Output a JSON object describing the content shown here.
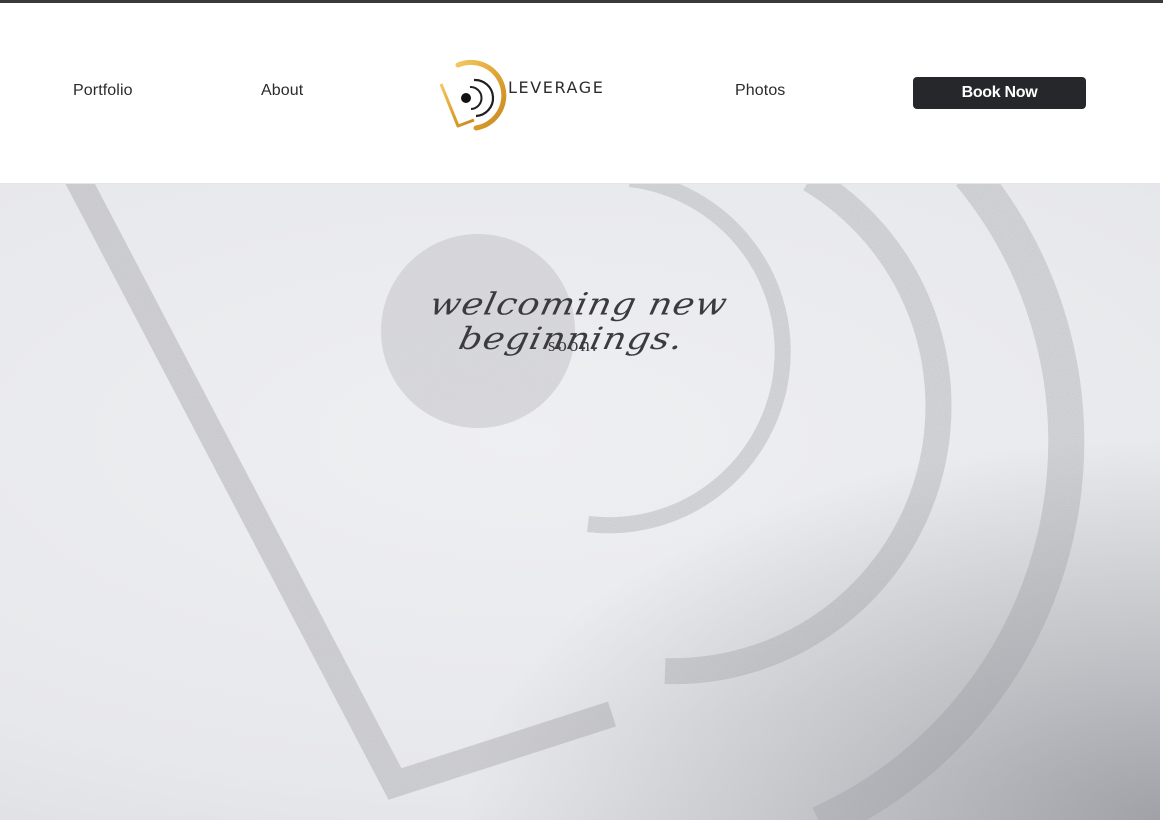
{
  "nav": {
    "portfolio": "Portfolio",
    "about": "About",
    "photos": "Photos",
    "book_now": "Book Now"
  },
  "logo": {
    "text": "LEVERAGE",
    "icon": "leverage-logo-icon",
    "colors": {
      "gold": "#e0a93a",
      "dark": "#1f1f1f"
    }
  },
  "hero": {
    "tagline": "welcoming new beginnings.",
    "subline": "soon."
  },
  "colors": {
    "button_bg": "#26272b",
    "button_text": "#ffffff",
    "hero_bg": "#e9eaed",
    "texture": "#b8b9bd"
  }
}
